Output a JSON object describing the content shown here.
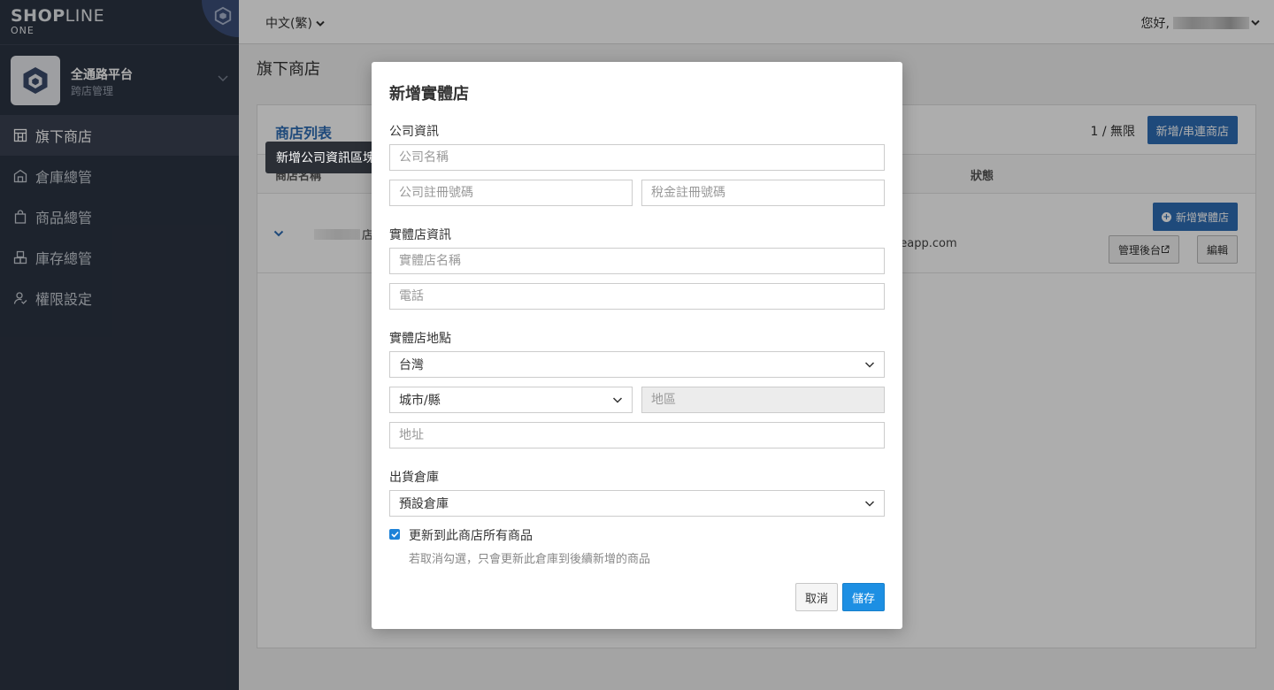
{
  "brand": {
    "name_bold": "SHOP",
    "name_light": "LINE",
    "sub": "ONE"
  },
  "org": {
    "title": "全通路平台",
    "subtitle": "跨店管理"
  },
  "sidebar": {
    "items": [
      {
        "label": "旗下商店",
        "icon": "store-icon"
      },
      {
        "label": "倉庫總管",
        "icon": "warehouse-icon"
      },
      {
        "label": "商品總管",
        "icon": "bag-icon"
      },
      {
        "label": "庫存總管",
        "icon": "boxes-icon"
      },
      {
        "label": "權限設定",
        "icon": "user-check-icon"
      }
    ]
  },
  "topbar": {
    "language": "中文(繁)",
    "greeting": "您好,"
  },
  "page": {
    "title": "旗下商店"
  },
  "store_list": {
    "title": "商店列表",
    "quota": "1 / 無限",
    "add_button": "新增/串連商店",
    "columns": {
      "name": "商店名稱",
      "status": "狀態"
    },
    "row": {
      "name_suffix": "店",
      "url_fragment": "neapp.com",
      "add_physical_button": "新增實體店",
      "admin_button": "管理後台",
      "edit_button": "編輯"
    }
  },
  "tooltip": {
    "text": "新增公司資訊區塊"
  },
  "modal": {
    "title": "新增實體店",
    "company_section": "公司資訊",
    "company_name_placeholder": "公司名稱",
    "company_reg_placeholder": "公司註冊號碼",
    "tax_reg_placeholder": "稅金註冊號碼",
    "store_section": "實體店資訊",
    "store_name_placeholder": "實體店名稱",
    "phone_placeholder": "電話",
    "location_section": "實體店地點",
    "country_value": "台灣",
    "city_value": "城市/縣",
    "district_placeholder": "地區",
    "address_placeholder": "地址",
    "warehouse_section": "出貨倉庫",
    "warehouse_value": "預設倉庫",
    "checkbox_label": "更新到此商店所有商品",
    "checkbox_checked": true,
    "checkbox_help": "若取消勾選，只會更新此倉庫到後續新增的商品",
    "cancel_button": "取消",
    "save_button": "儲存"
  },
  "colors": {
    "sidebar_bg": "#2c3443",
    "primary": "#2f6db5",
    "save": "#1d8fe3"
  }
}
